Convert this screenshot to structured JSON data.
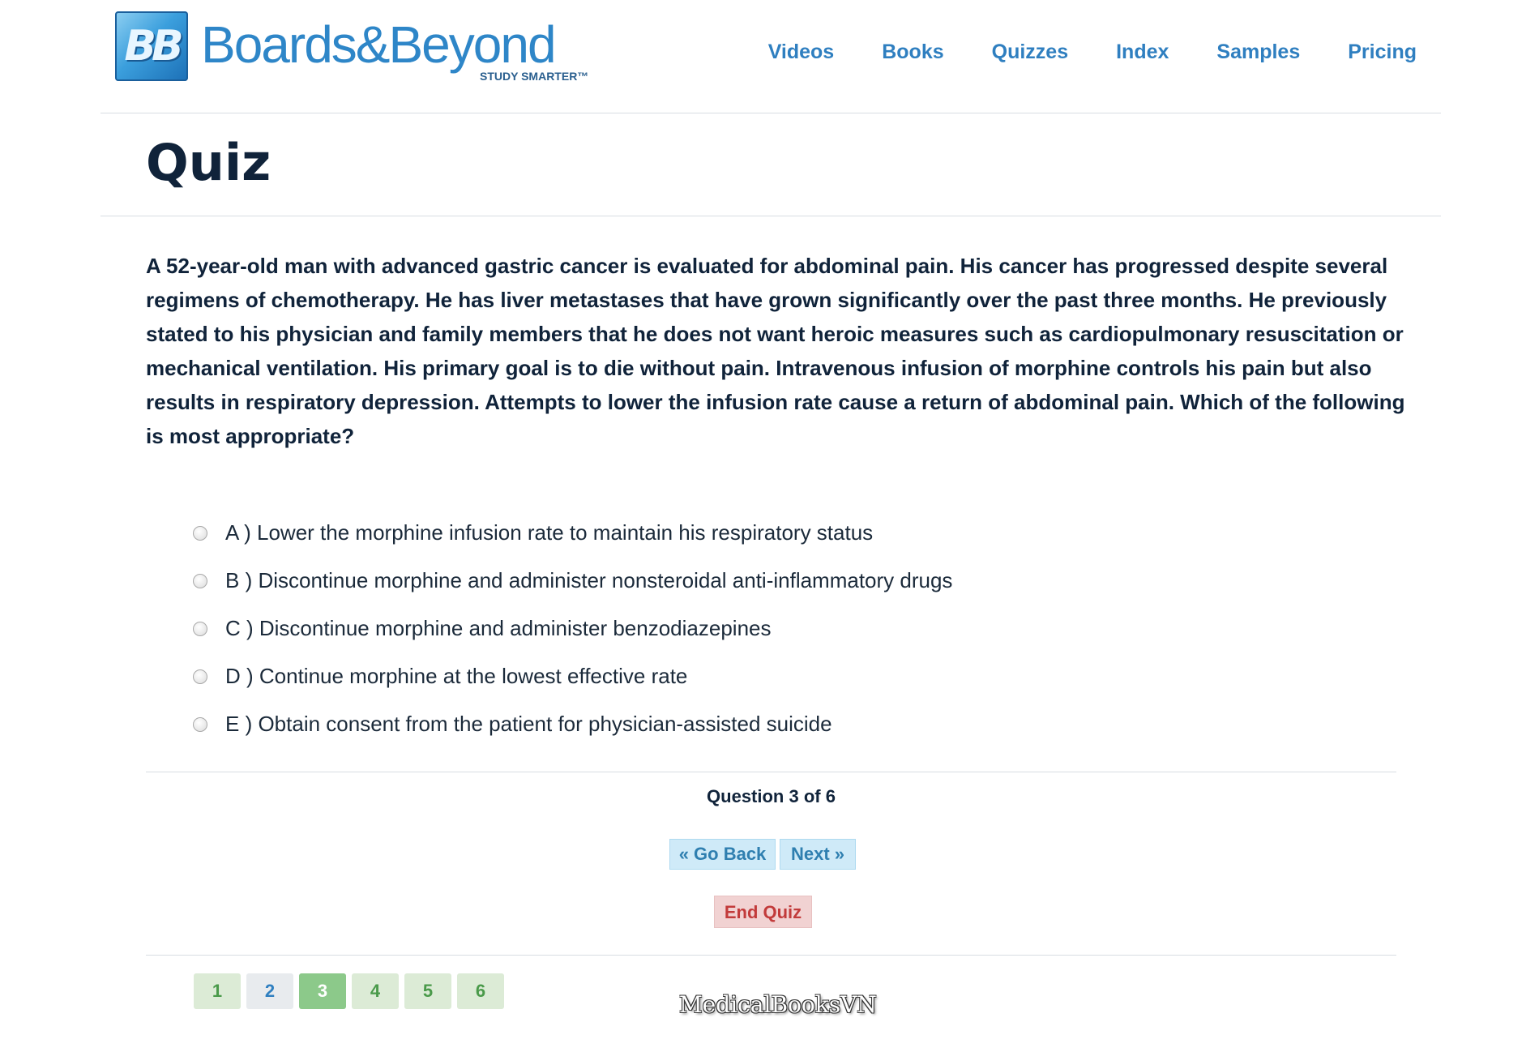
{
  "brand": {
    "logo_mark": "BB",
    "name": "Boards&Beyond",
    "tagline": "STUDY SMARTER™",
    "colors": {
      "primary": "#2e86c8",
      "dark_text": "#10233a",
      "answered_green": "#dcebd6",
      "current_green": "#8cc98a",
      "end_red": "#c23b3b",
      "button_blue": "#cfeaf8"
    }
  },
  "nav": {
    "items": [
      "Videos",
      "Books",
      "Quizzes",
      "Index",
      "Samples",
      "Pricing"
    ]
  },
  "page_title": "Quiz",
  "question": {
    "stem": "A 52-year-old man with advanced gastric cancer is evaluated for abdominal pain. His cancer has progressed despite several regimens of chemotherapy. He has liver metastases that have grown significantly over the past three months. He previously stated to his physician and family members that he does not want heroic measures such as cardiopulmonary resuscitation or mechanical ventilation. His primary goal is to die without pain. Intravenous infusion of morphine controls his pain but also results in respiratory depression. Attempts to lower the infusion rate cause a return of abdominal pain. Which of the following is most appropriate?",
    "answers": [
      {
        "label": "A ) Lower the morphine infusion rate to maintain his respiratory status"
      },
      {
        "label": "B ) Discontinue morphine and administer nonsteroidal anti-inflammatory drugs"
      },
      {
        "label": "C ) Discontinue morphine and administer benzodiazepines"
      },
      {
        "label": "D ) Continue morphine at the lowest effective rate"
      },
      {
        "label": "E ) Obtain consent from the patient for physician-assisted suicide"
      }
    ]
  },
  "progress": {
    "text": "Question 3 of 6",
    "current": 3,
    "total": 6
  },
  "buttons": {
    "back": "« Go Back",
    "next": "Next »",
    "end": "End Quiz"
  },
  "pager": [
    "1",
    "2",
    "3",
    "4",
    "5",
    "6"
  ],
  "watermark": "MedicalBooksVN"
}
